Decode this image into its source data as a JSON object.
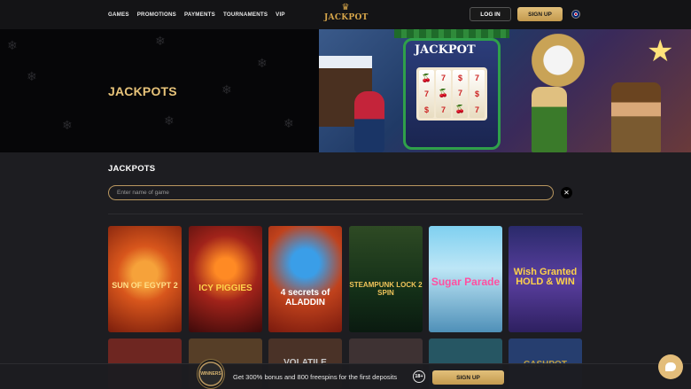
{
  "header": {
    "nav": [
      "GAMES",
      "PROMOTIONS",
      "PAYMENTS",
      "TOURNAMENTS",
      "VIP"
    ],
    "logo_text": "JACKPOT",
    "login_label": "LOG IN",
    "signup_label": "SIGN UP",
    "language_icon": "uk-flag-icon"
  },
  "banner": {
    "title": "JACKPOTS",
    "slot_sign": "JACKPOT"
  },
  "section": {
    "title": "JACKPOTS",
    "search_placeholder": "Enter name of game",
    "clear_icon": "close-icon"
  },
  "games_row1": [
    {
      "title": "SUN OF EGYPT 2"
    },
    {
      "title": "ICY PIGGIES"
    },
    {
      "title": "4 secrets of ALADDIN"
    },
    {
      "title": "STEAMPUNK LOCK 2 SPIN"
    },
    {
      "title": "Sugar Parade"
    },
    {
      "title": "Wish Granted HOLD & WIN"
    }
  ],
  "games_row2": [
    {
      "title": ""
    },
    {
      "title": ""
    },
    {
      "title": "VOLATILE"
    },
    {
      "title": ""
    },
    {
      "title": ""
    },
    {
      "title": "CASHPOT"
    }
  ],
  "promo": {
    "badge_text": "WINNERS",
    "text": "Get 300% bonus and 800 freespins for the first deposits",
    "age_label": "18+",
    "button_label": "SIGN UP"
  },
  "colors": {
    "accent_gold": "#e2c07b",
    "background": "#1d1d21"
  }
}
